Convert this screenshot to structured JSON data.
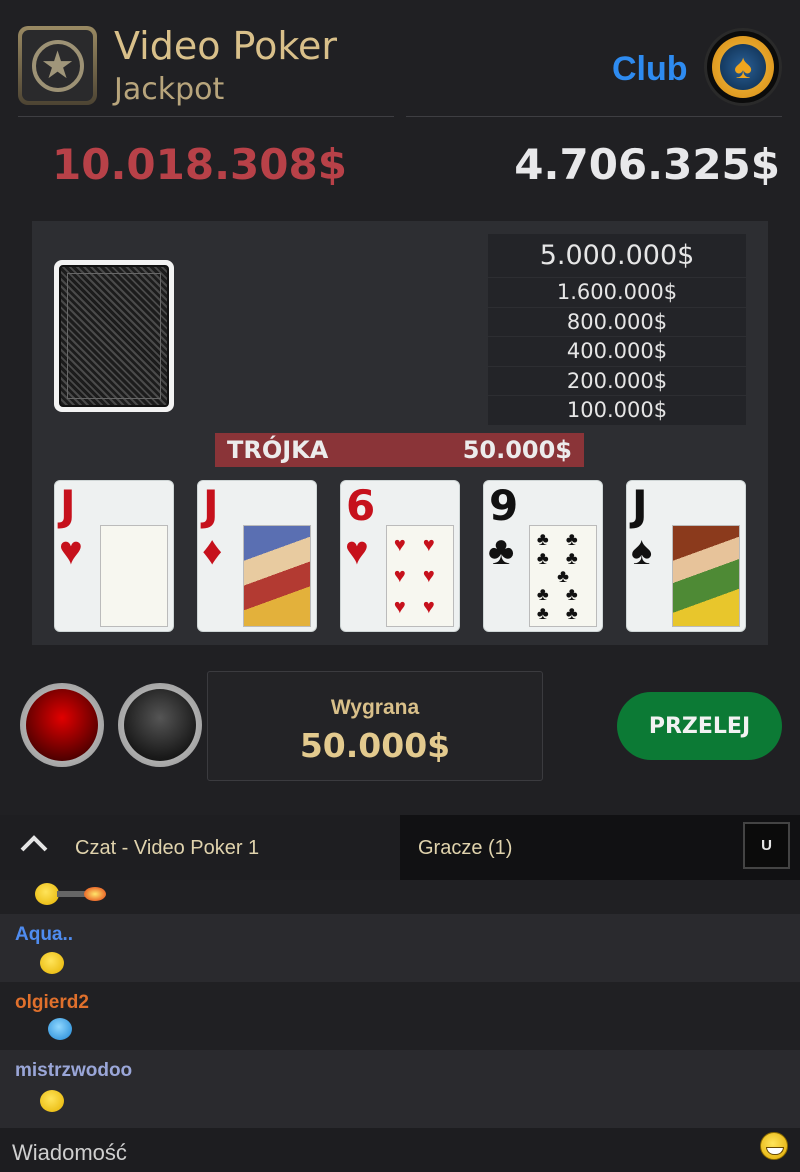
{
  "header": {
    "title": "Video Poker",
    "subtitle": "Jackpot",
    "club_label": "Club",
    "jackpot_amount": "10.018.308$",
    "balance": "4.706.325$"
  },
  "paytable": [
    "5.000.000$",
    "1.600.000$",
    "800.000$",
    "400.000$",
    "200.000$",
    "100.000$"
  ],
  "result": {
    "hand": "TRÓJKA",
    "amount": "50.000$"
  },
  "cards": [
    {
      "rank": "J",
      "suit": "♥",
      "color": "red"
    },
    {
      "rank": "J",
      "suit": "♦",
      "color": "red"
    },
    {
      "rank": "6",
      "suit": "♥",
      "color": "red"
    },
    {
      "rank": "9",
      "suit": "♣",
      "color": "black"
    },
    {
      "rank": "J",
      "suit": "♠",
      "color": "black"
    }
  ],
  "controls": {
    "win_label": "Wygrana",
    "win_amount": "50.000$",
    "transfer_label": "PRZELEJ"
  },
  "chat": {
    "tab_chat": "Czat - Video Poker 1",
    "tab_players": "Gracze  (1)",
    "u_button": "U",
    "messages": [
      {
        "user": "",
        "emoticon": "smiley-gun"
      },
      {
        "user": "Aqua..",
        "color": "#4f8cf0",
        "emoticon": "smiley"
      },
      {
        "user": "olgierd2",
        "color": "#e0702c",
        "emoticon": "blue-smiley"
      },
      {
        "user": "mistrzwodoo",
        "color": "#9aa6d8",
        "emoticon": "smiley"
      }
    ],
    "input_placeholder": "Wiadomość"
  },
  "colors": {
    "jackpot": "#b84148",
    "gold": "#d9c08a",
    "accent_green": "#0c7a35",
    "club_blue": "#2e8bf0"
  }
}
